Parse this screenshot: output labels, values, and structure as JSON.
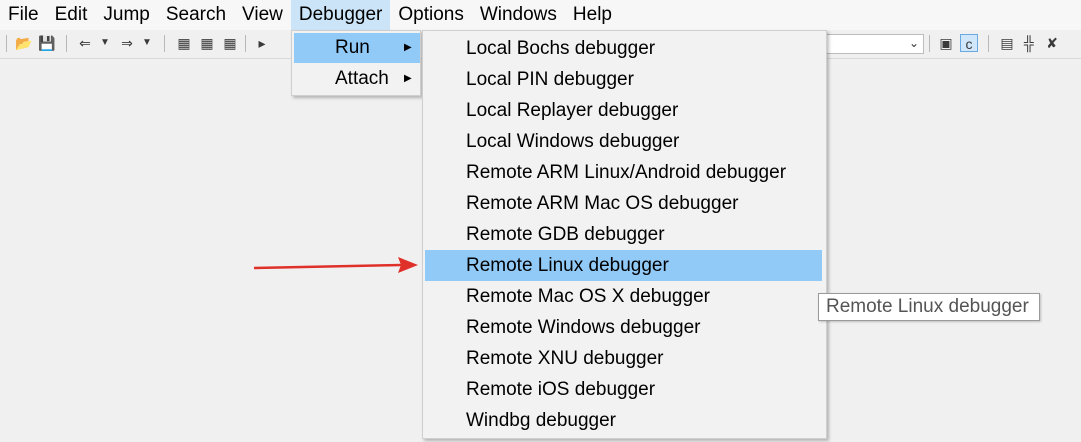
{
  "menubar": {
    "items": [
      "File",
      "Edit",
      "Jump",
      "Search",
      "View",
      "Debugger",
      "Options",
      "Windows",
      "Help"
    ],
    "active": "Debugger"
  },
  "debugger_menu": {
    "items": [
      {
        "label": "Run",
        "has_submenu": true,
        "highlighted": true
      },
      {
        "label": "Attach",
        "has_submenu": true,
        "highlighted": false
      }
    ]
  },
  "run_submenu": {
    "items": [
      "Local Bochs debugger",
      "Local PIN debugger",
      "Local Replayer debugger",
      "Local Windows debugger",
      "Remote ARM Linux/Android debugger",
      "Remote ARM Mac OS debugger",
      "Remote GDB debugger",
      "Remote Linux debugger",
      "Remote Mac OS X debugger",
      "Remote Windows debugger",
      "Remote XNU debugger",
      "Remote iOS debugger",
      "Windbg debugger"
    ],
    "highlighted": "Remote Linux debugger"
  },
  "tooltip": {
    "text": "Remote Linux debugger"
  },
  "colors": {
    "menu_highlight": "#91c9f7",
    "menubar_active": "#cce4f7",
    "annotation_arrow": "#e0302a"
  }
}
